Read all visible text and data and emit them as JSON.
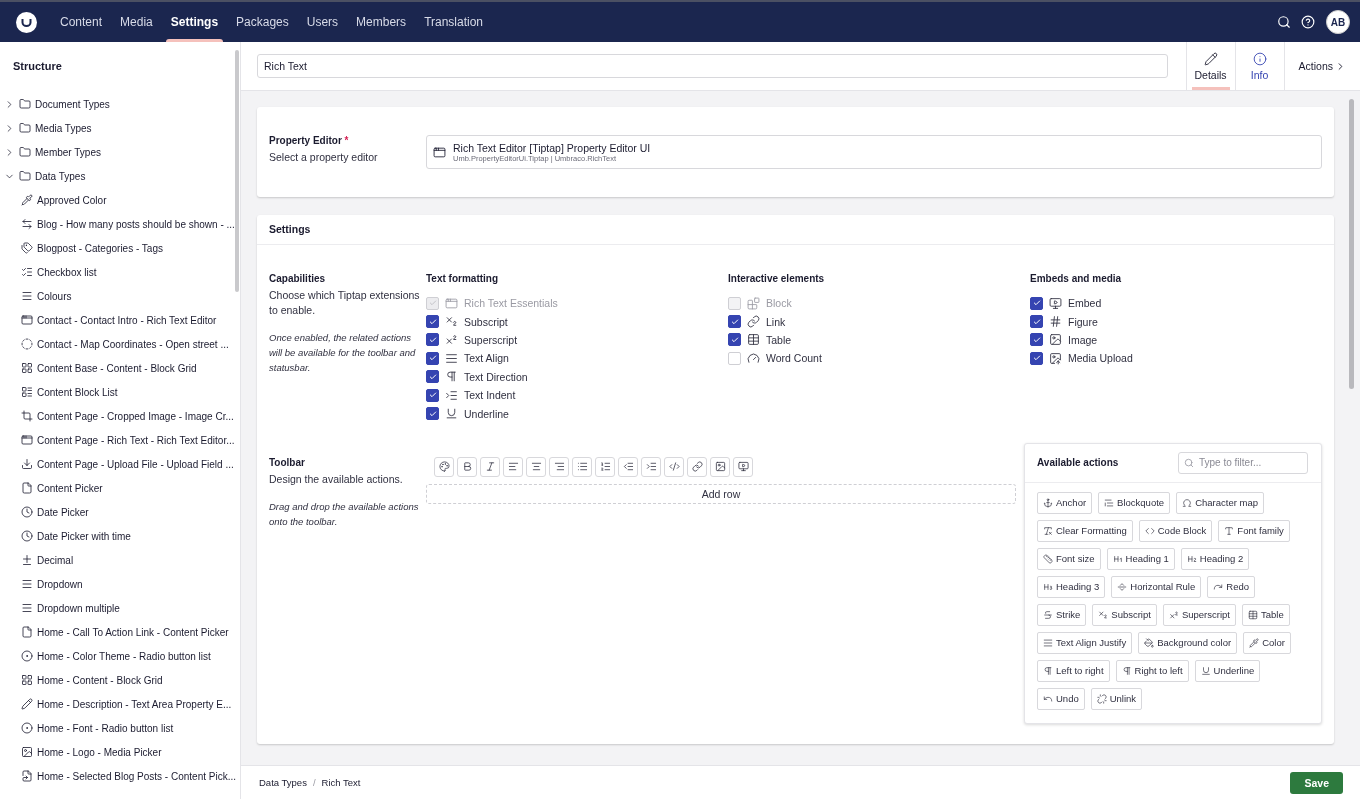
{
  "nav": {
    "items": [
      {
        "label": "Content",
        "selected": false
      },
      {
        "label": "Media",
        "selected": false
      },
      {
        "label": "Settings",
        "selected": true
      },
      {
        "label": "Packages",
        "selected": false
      },
      {
        "label": "Users",
        "selected": false
      },
      {
        "label": "Members",
        "selected": false
      },
      {
        "label": "Translation",
        "selected": false
      }
    ],
    "avatar": "AB"
  },
  "sidebar": {
    "title": "Structure",
    "items": [
      {
        "label": "Document Types",
        "expanded": false
      },
      {
        "label": "Media Types",
        "expanded": false
      },
      {
        "label": "Member Types",
        "expanded": false
      },
      {
        "label": "Data Types",
        "expanded": true,
        "children": [
          {
            "label": "Approved Color"
          },
          {
            "label": "Blog - How many posts should be shown - ..."
          },
          {
            "label": "Blogpost - Categories - Tags"
          },
          {
            "label": "Checkbox list"
          },
          {
            "label": "Colours"
          },
          {
            "label": "Contact - Contact Intro - Rich Text Editor"
          },
          {
            "label": "Contact - Map Coordinates - Open street ..."
          },
          {
            "label": "Content Base - Content - Block Grid"
          },
          {
            "label": "Content Block List"
          },
          {
            "label": "Content Page - Cropped Image - Image Cr..."
          },
          {
            "label": "Content Page - Rich Text - Rich Text Editor..."
          },
          {
            "label": "Content Page - Upload File - Upload Field ..."
          },
          {
            "label": "Content Picker"
          },
          {
            "label": "Date Picker"
          },
          {
            "label": "Date Picker with time"
          },
          {
            "label": "Decimal"
          },
          {
            "label": "Dropdown"
          },
          {
            "label": "Dropdown multiple"
          },
          {
            "label": "Home - Call To Action Link - Content Picker"
          },
          {
            "label": "Home - Color Theme - Radio button list"
          },
          {
            "label": "Home - Content - Block Grid"
          },
          {
            "label": "Home - Description - Text Area Property E..."
          },
          {
            "label": "Home - Font - Radio button list"
          },
          {
            "label": "Home - Logo - Media Picker"
          },
          {
            "label": "Home - Selected Blog Posts - Content Pick..."
          }
        ]
      }
    ]
  },
  "header": {
    "name": "Rich Text",
    "tabs": [
      {
        "label": "Details",
        "selected": true
      },
      {
        "label": "Info",
        "selected": false
      }
    ],
    "actions": "Actions"
  },
  "property_editor": {
    "label": "Property Editor",
    "required_mark": "*",
    "description": "Select a property editor",
    "editor_name": "Rich Text Editor [Tiptap] Property Editor UI",
    "editor_alias": "Umb.PropertyEditorUi.Tiptap | Umbraco.RichText"
  },
  "settings": {
    "title": "Settings",
    "capabilities": {
      "label": "Capabilities",
      "description": "Choose which Tiptap extensions to enable.",
      "hint": "Once enabled, the related actions will be available for the toolbar and statusbar.",
      "groups": [
        {
          "title": "Text formatting",
          "items": [
            {
              "label": "Rich Text Essentials",
              "checked": true,
              "disabled": true
            },
            {
              "label": "Subscript",
              "checked": true,
              "disabled": false
            },
            {
              "label": "Superscript",
              "checked": true,
              "disabled": false
            },
            {
              "label": "Text Align",
              "checked": true,
              "disabled": false
            },
            {
              "label": "Text Direction",
              "checked": true,
              "disabled": false
            },
            {
              "label": "Text Indent",
              "checked": true,
              "disabled": false
            },
            {
              "label": "Underline",
              "checked": true,
              "disabled": false
            }
          ]
        },
        {
          "title": "Interactive elements",
          "items": [
            {
              "label": "Block",
              "checked": false,
              "disabled": true
            },
            {
              "label": "Link",
              "checked": true,
              "disabled": false
            },
            {
              "label": "Table",
              "checked": true,
              "disabled": false
            },
            {
              "label": "Word Count",
              "checked": false,
              "disabled": false
            }
          ]
        },
        {
          "title": "Embeds and media",
          "items": [
            {
              "label": "Embed",
              "checked": true,
              "disabled": false
            },
            {
              "label": "Figure",
              "checked": true,
              "disabled": false
            },
            {
              "label": "Image",
              "checked": true,
              "disabled": false
            },
            {
              "label": "Media Upload",
              "checked": true,
              "disabled": false
            }
          ]
        }
      ]
    },
    "toolbar": {
      "label": "Toolbar",
      "description": "Design the available actions.",
      "hint": "Drag and drop the available actions onto the toolbar.",
      "add_row": "Add row"
    },
    "available_actions": {
      "title": "Available actions",
      "filter_placeholder": "Type to filter...",
      "actions": [
        "Anchor",
        "Blockquote",
        "Character map",
        "Clear Formatting",
        "Code Block",
        "Font family",
        "Font size",
        "Heading 1",
        "Heading 2",
        "Heading 3",
        "Horizontal Rule",
        "Redo",
        "Strike",
        "Subscript",
        "Superscript",
        "Table",
        "Text Align Justify",
        "Background color",
        "Color",
        "Left to right",
        "Right to left",
        "Underline",
        "Undo",
        "Unlink"
      ]
    }
  },
  "footer": {
    "breadcrumbs": [
      "Data Types",
      "Rich Text"
    ],
    "separator": "/",
    "save": "Save"
  }
}
